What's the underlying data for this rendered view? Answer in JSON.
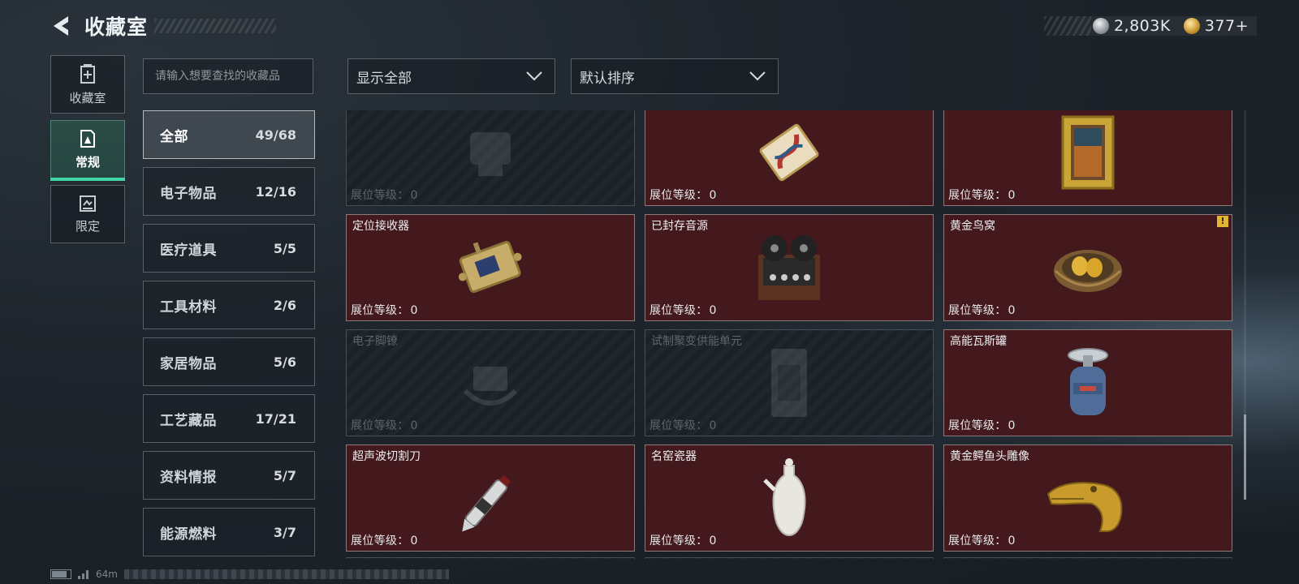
{
  "header": {
    "title": "收藏室"
  },
  "currency": [
    {
      "icon": "silver-coin-icon",
      "value": "2,803K"
    },
    {
      "icon": "gold-coin-icon",
      "value": "377+"
    }
  ],
  "rail": [
    {
      "key": "collection",
      "label": "收藏室",
      "icon": "collection-room-icon"
    },
    {
      "key": "regular",
      "label": "常规",
      "icon": "regular-icon",
      "active": true
    },
    {
      "key": "limited",
      "label": "限定",
      "icon": "limited-icon"
    }
  ],
  "search": {
    "placeholder": "请输入想要查找的收藏品"
  },
  "categories": [
    {
      "name": "全部",
      "count": "49/68",
      "active": true
    },
    {
      "name": "电子物品",
      "count": "12/16"
    },
    {
      "name": "医疗道具",
      "count": "5/5"
    },
    {
      "name": "工具材料",
      "count": "2/6"
    },
    {
      "name": "家居物品",
      "count": "5/6"
    },
    {
      "name": "工艺藏品",
      "count": "17/21"
    },
    {
      "name": "资料情报",
      "count": "5/7"
    },
    {
      "name": "能源燃料",
      "count": "3/7"
    }
  ],
  "filters": {
    "display": "显示全部",
    "sort": "默认排序"
  },
  "level_label": "展位等级：",
  "items": [
    {
      "name": "",
      "level": "0",
      "locked": true,
      "image": "device-icon"
    },
    {
      "name": "",
      "level": "0",
      "locked": false,
      "image": "ornate-card-icon"
    },
    {
      "name": "",
      "level": "0",
      "locked": false,
      "image": "framed-painting-icon"
    },
    {
      "name": "定位接收器",
      "level": "0",
      "locked": false,
      "image": "locator-receiver-icon"
    },
    {
      "name": "已封存音源",
      "level": "0",
      "locked": false,
      "image": "reel-recorder-icon"
    },
    {
      "name": "黄金鸟窝",
      "level": "0",
      "locked": false,
      "image": "golden-nest-icon",
      "badge": "!"
    },
    {
      "name": "电子脚镣",
      "level": "0",
      "locked": true,
      "image": "ankle-monitor-icon"
    },
    {
      "name": "试制聚变供能单元",
      "level": "0",
      "locked": true,
      "image": "fusion-cell-icon"
    },
    {
      "name": "高能瓦斯罐",
      "level": "0",
      "locked": false,
      "image": "gas-canister-icon"
    },
    {
      "name": "超声波切割刀",
      "level": "0",
      "locked": false,
      "image": "ultrasonic-cutter-icon"
    },
    {
      "name": "名窑瓷器",
      "level": "0",
      "locked": false,
      "image": "porcelain-vase-icon"
    },
    {
      "name": "黄金鳄鱼头雕像",
      "level": "0",
      "locked": false,
      "image": "golden-crocodile-icon"
    }
  ],
  "status": {
    "signal": "64m"
  }
}
